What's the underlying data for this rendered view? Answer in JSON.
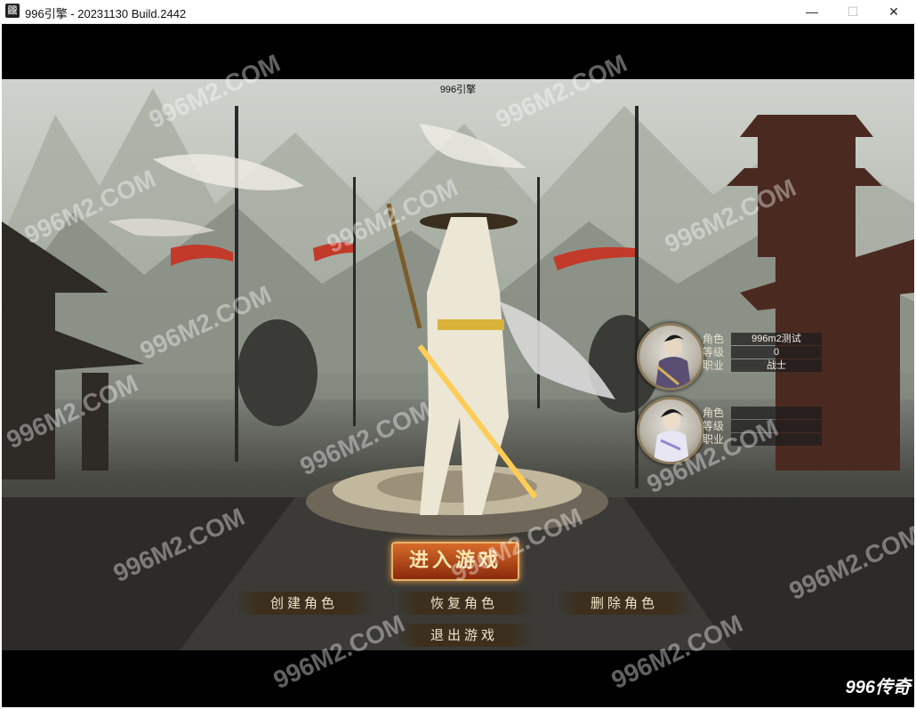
{
  "window": {
    "icon_glyph": "龖",
    "title": "996引擎 - 20231130 Build.2442",
    "min_glyph": "—",
    "max_glyph": "☐",
    "close_glyph": "✕"
  },
  "scene": {
    "caption": "996引擎"
  },
  "characters": [
    {
      "rows": [
        {
          "key": "角色",
          "value": "996m2测试"
        },
        {
          "key": "等级",
          "value": "0"
        },
        {
          "key": "职业",
          "value": "战士"
        }
      ]
    },
    {
      "rows": [
        {
          "key": "角色",
          "value": ""
        },
        {
          "key": "等级",
          "value": ""
        },
        {
          "key": "职业",
          "value": ""
        }
      ]
    }
  ],
  "buttons": {
    "enter": "进入游戏",
    "create": "创建角色",
    "restore": "恢复角色",
    "delete": "删除角色",
    "exit": "退出游戏"
  },
  "watermark": "996M2.COM",
  "brand": "996传奇",
  "colors": {
    "enter_bg": "#b04a18",
    "panel_bg": "#1e1e1e",
    "text_gold": "#efe4c8"
  }
}
